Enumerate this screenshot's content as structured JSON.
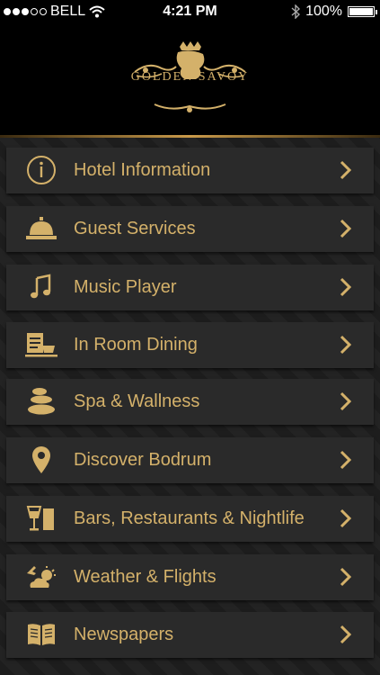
{
  "status_bar": {
    "carrier": "BELL",
    "time": "4:21 PM",
    "battery": "100%",
    "signal_bars_filled": 3,
    "signal_bars_total": 5
  },
  "brand": {
    "name": "GOLDEN SAVOY"
  },
  "colors": {
    "gold": "#d4b16a",
    "tile": "#2a2a2a",
    "background": "#1b1b1b"
  },
  "menu": [
    {
      "label": "Hotel Information",
      "icon": "info-icon"
    },
    {
      "label": "Guest Services",
      "icon": "service-bell-icon"
    },
    {
      "label": "Music Player",
      "icon": "music-note-icon"
    },
    {
      "label": "In Room Dining",
      "icon": "dining-icon"
    },
    {
      "label": "Spa & Wallness",
      "icon": "spa-stones-icon"
    },
    {
      "label": "Discover Bodrum",
      "icon": "map-pin-icon"
    },
    {
      "label": "Bars, Restaurants & Nightlife",
      "icon": "drinks-icon"
    },
    {
      "label": "Weather & Flights",
      "icon": "weather-plane-icon"
    },
    {
      "label": "Newspapers",
      "icon": "book-icon"
    }
  ]
}
